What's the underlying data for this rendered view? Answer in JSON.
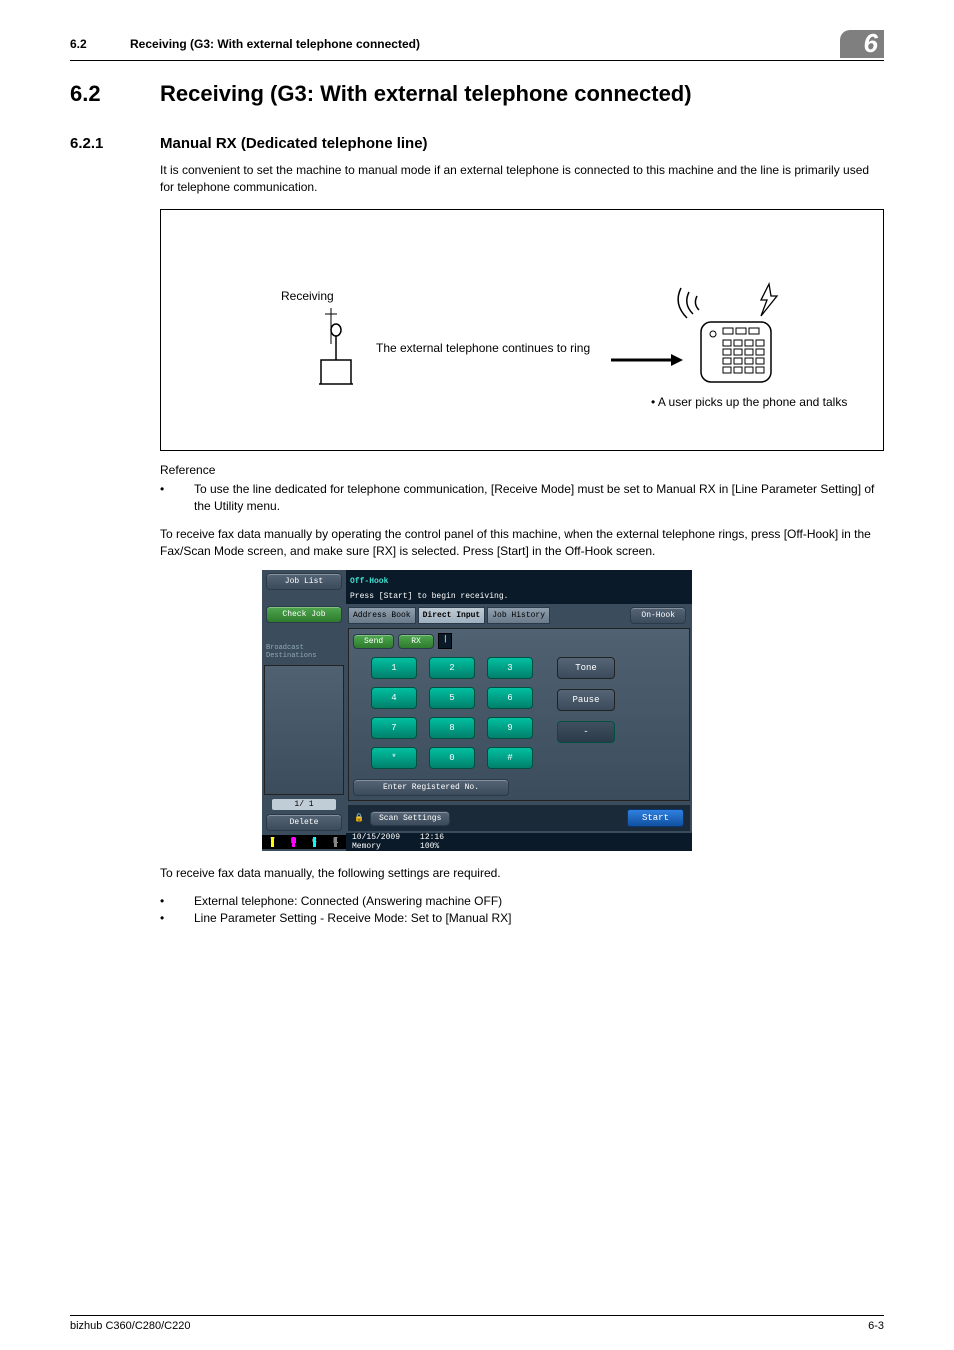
{
  "header": {
    "section_number": "6.2",
    "section_title": "Receiving (G3: With external telephone connected)",
    "chapter": "6"
  },
  "h2": {
    "number": "6.2",
    "title": "Receiving (G3: With external telephone connected)"
  },
  "h3": {
    "number": "6.2.1",
    "title": "Manual RX (Dedicated telephone line)"
  },
  "intro": "It is convenient to set the machine to manual mode if an external telephone is connected to this machine and the line is primarily used for telephone communication.",
  "diagram": {
    "receiving_label": "Receiving",
    "ring_text": "The external telephone continues to ring",
    "user_note": "• A user picks up the phone and talks"
  },
  "reference_heading": "Reference",
  "reference_bullet": "To use the line dedicated for telephone communication, [Receive Mode] must be set to Manual RX in [Line Parameter Setting] of the Utility menu.",
  "manual_rx_para": "To receive fax data manually by operating the control panel of this machine, when the external telephone rings, press [Off-Hook] in the Fax/Scan Mode screen, and make sure [RX] is selected. Press [Start] in the Off-Hook screen.",
  "required_intro": "To receive fax data manually, the following settings are required.",
  "required_bullets": [
    "External telephone: Connected (Answering machine OFF)",
    "Line Parameter Setting - Receive Mode: Set to [Manual RX]"
  ],
  "screenshot": {
    "left": {
      "job_list": "Job List",
      "check_job": "Check Job",
      "broadcast": "Broadcast Destinations",
      "pager": "1/  1",
      "delete": "Delete",
      "ymck": [
        "Y",
        "M",
        "C",
        "K"
      ]
    },
    "top": {
      "off_hook_title": "Off-Hook",
      "instruction": "Press [Start] to begin receiving.",
      "tab_address": "Address Book",
      "tab_direct": "Direct Input",
      "tab_history": "Job History",
      "on_hook": "On-Hook",
      "send": "Send",
      "rx": "RX"
    },
    "keypad": [
      "1",
      "2",
      "3",
      "4",
      "5",
      "6",
      "7",
      "8",
      "9",
      "*",
      "0",
      "#"
    ],
    "side": {
      "tone": "Tone",
      "pause": "Pause",
      "hyphen": "-"
    },
    "enter_reg": "Enter Registered No.",
    "scan_settings": "Scan Settings",
    "start": "Start",
    "status": {
      "date": "10/15/2009",
      "time": "12:16",
      "memory_label": "Memory",
      "memory_pct": "100%"
    }
  },
  "footer": {
    "model": "bizhub C360/C280/C220",
    "page": "6-3"
  }
}
